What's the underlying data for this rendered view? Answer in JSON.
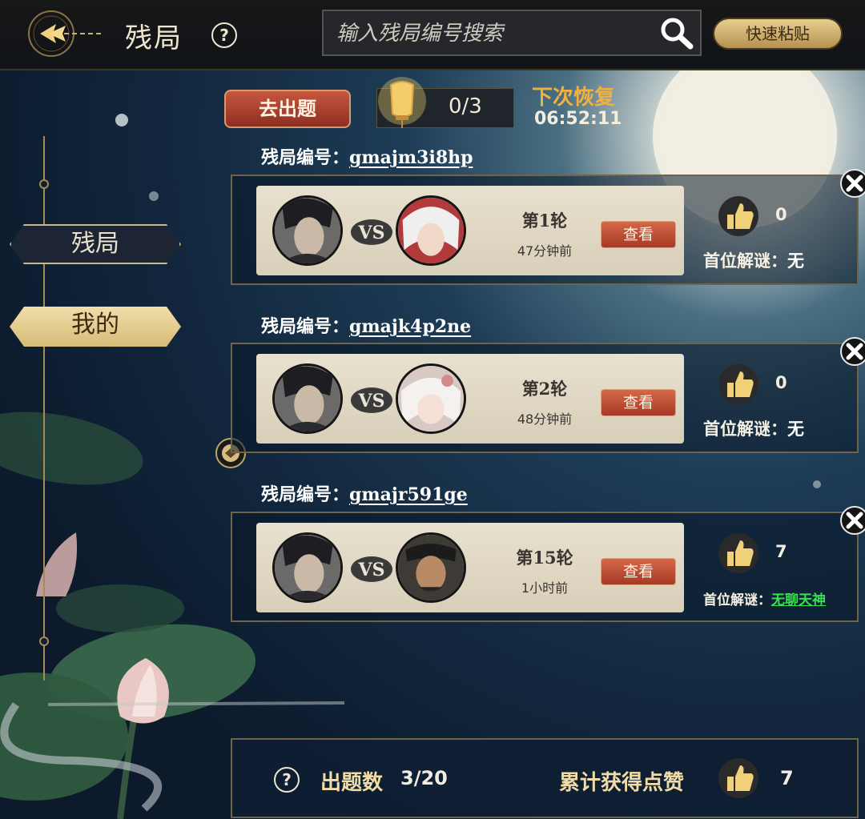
{
  "header": {
    "title": "残局",
    "help_symbol": "?",
    "search_placeholder": "输入残局编号搜索",
    "paste_label": "快速粘贴"
  },
  "sidebar": {
    "tabs": [
      {
        "label": "残局",
        "selected": false
      },
      {
        "label": "我的",
        "selected": true
      }
    ]
  },
  "challenge": {
    "go_button": "去出题",
    "attempts": "0/3",
    "recover_label": "下次恢复",
    "recover_time": "06:52:11"
  },
  "puzzles": [
    {
      "id_label": "残局编号：",
      "id": "gmajm3i8hp",
      "round": "第1轮",
      "time_ago": "47分钟前",
      "view": "查看",
      "likes": "0",
      "first_label": "首位解谜：",
      "first_solver": "无"
    },
    {
      "id_label": "残局编号：",
      "id": "gmajk4p2ne",
      "round": "第2轮",
      "time_ago": "48分钟前",
      "view": "查看",
      "likes": "0",
      "first_label": "首位解谜：",
      "first_solver": "无"
    },
    {
      "id_label": "残局编号：",
      "id": "gmajr591ge",
      "round": "第15轮",
      "time_ago": "1小时前",
      "view": "查看",
      "likes": "7",
      "first_label": "首位解谜：",
      "first_solver": "无聊天神"
    }
  ],
  "footer": {
    "questions_label": "出题数",
    "questions_value": "3/20",
    "likes_label": "累计获得点赞",
    "likes_value": "7"
  },
  "colors": {
    "accent_gold": "#d8bb77",
    "button_red": "#a63a25",
    "solver_green": "#37e04f",
    "recover_orange": "#f2b13c"
  }
}
